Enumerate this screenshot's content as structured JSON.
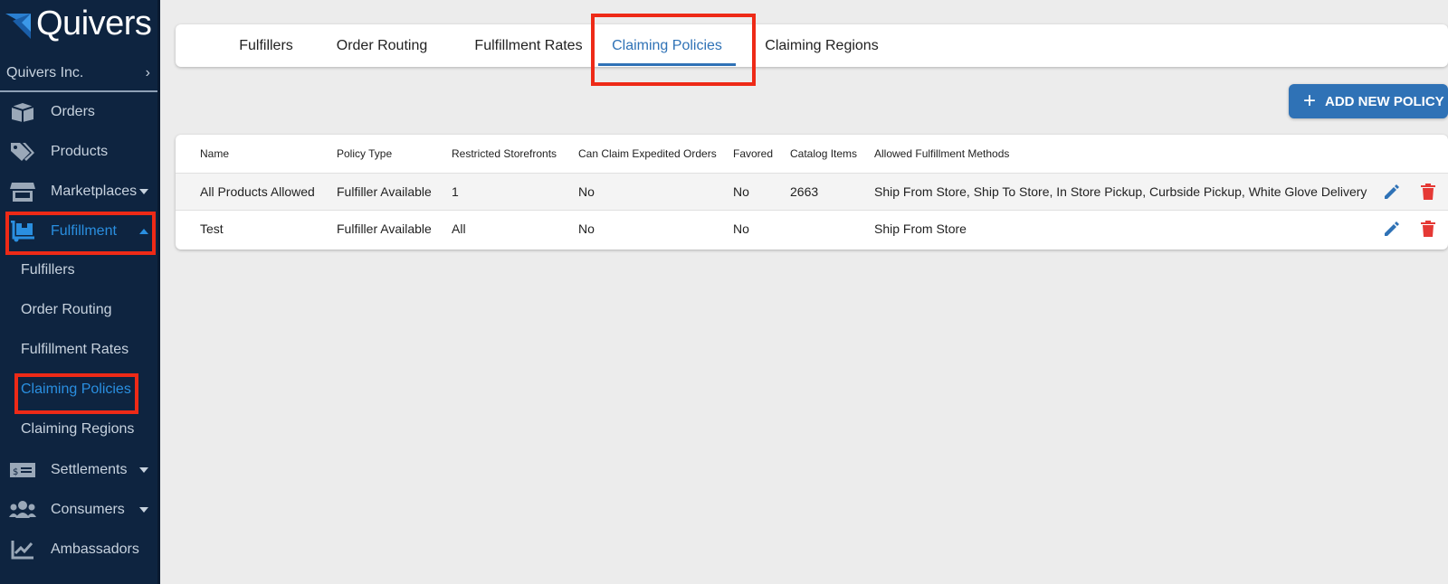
{
  "sidebar": {
    "logo_text": "Quivers",
    "org_name": "Quivers Inc.",
    "items": [
      {
        "label": "Orders",
        "icon": "box-icon"
      },
      {
        "label": "Products",
        "icon": "tags-icon"
      },
      {
        "label": "Marketplaces",
        "icon": "store-icon"
      },
      {
        "label": "Fulfillment",
        "icon": "dolly-icon"
      },
      {
        "label": "Settlements",
        "icon": "money-bill-icon"
      },
      {
        "label": "Consumers",
        "icon": "users-icon"
      },
      {
        "label": "Ambassadors",
        "icon": "chart-line-icon"
      }
    ],
    "sub_items": [
      {
        "label": "Fulfillers"
      },
      {
        "label": "Order Routing"
      },
      {
        "label": "Fulfillment Rates"
      },
      {
        "label": "Claiming Policies"
      },
      {
        "label": "Claiming Regions"
      }
    ]
  },
  "tabs": [
    {
      "label": "Fulfillers"
    },
    {
      "label": "Order Routing"
    },
    {
      "label": "Fulfillment Rates"
    },
    {
      "label": "Claiming Policies"
    },
    {
      "label": "Claiming Regions"
    }
  ],
  "add_button_label": "ADD NEW POLICY",
  "table": {
    "headers": [
      "Name",
      "Policy Type",
      "Restricted Storefronts",
      "Can Claim Expedited Orders",
      "Favored",
      "Catalog Items",
      "Allowed Fulfillment Methods"
    ],
    "rows": [
      {
        "name": "All Products Allowed",
        "policy_type": "Fulfiller Available",
        "restricted": "1",
        "expedited": "No",
        "favored": "No",
        "catalog": "2663",
        "methods": "Ship From Store, Ship To Store, In Store Pickup, Curbside Pickup, White Glove Delivery"
      },
      {
        "name": "Test",
        "policy_type": "Fulfiller Available",
        "restricted": "All",
        "expedited": "No",
        "favored": "No",
        "catalog": "",
        "methods": "Ship From Store"
      }
    ]
  },
  "colors": {
    "sidebar_bg": "#0e2440",
    "accent": "#2f72b6",
    "highlight": "#ee2a17",
    "delete": "#e53935"
  }
}
